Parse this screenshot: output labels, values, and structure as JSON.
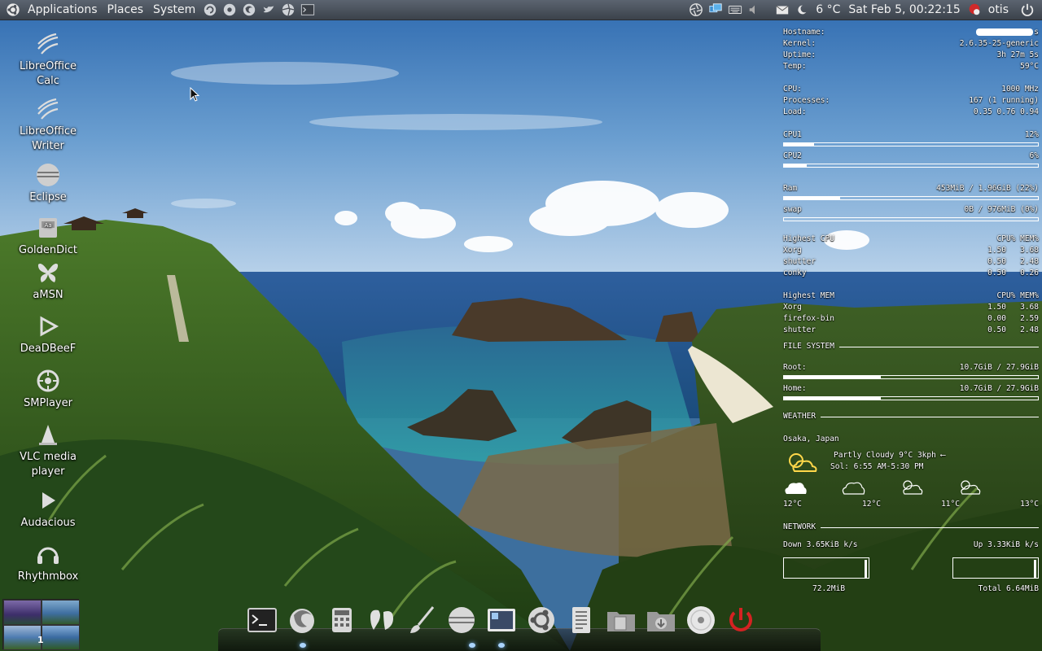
{
  "top_panel": {
    "menus": [
      "Applications",
      "Places",
      "System"
    ],
    "weather": "6 °C",
    "clock": "Sat Feb  5, 00:22:15",
    "user": "otis"
  },
  "desktop_icons": [
    {
      "label": "LibreOffice Calc",
      "icon": "libreoffice-calc-icon"
    },
    {
      "label": "LibreOffice Writer",
      "icon": "libreoffice-writer-icon"
    },
    {
      "label": "Eclipse",
      "icon": "eclipse-icon"
    },
    {
      "label": "GoldenDict",
      "icon": "goldendict-icon"
    },
    {
      "label": "aMSN",
      "icon": "amsn-icon"
    },
    {
      "label": "DeaDBeeF",
      "icon": "deadbeef-icon"
    },
    {
      "label": "SMPlayer",
      "icon": "smplayer-icon"
    },
    {
      "label": "VLC media player",
      "icon": "vlc-icon"
    },
    {
      "label": "Audacious",
      "icon": "audacious-icon"
    },
    {
      "label": "Rhythmbox",
      "icon": "rhythmbox-icon"
    }
  ],
  "conky": {
    "system": [
      {
        "label": "Hostname:",
        "value": "s"
      },
      {
        "label": "Kernel:",
        "value": "2.6.35-25-generic"
      },
      {
        "label": "Uptime:",
        "value": "3h 27m 5s"
      },
      {
        "label": "Temp:",
        "value": "59°C"
      }
    ],
    "cpu_info": [
      {
        "label": "CPU:",
        "value": "1000 MHz"
      },
      {
        "label": "Processes:",
        "value": "167 (1 running)"
      },
      {
        "label": "Load:",
        "value": "0.35 0.76 0.94"
      }
    ],
    "cpu1": {
      "label": "CPU1",
      "value": "12%",
      "fraction": 0.12
    },
    "cpu2": {
      "label": "CPU2",
      "value": "6%",
      "fraction": 0.09
    },
    "ram": {
      "label": "Ram",
      "value": "453MiB / 1.96GiB (22%)",
      "fraction": 0.22
    },
    "swap": {
      "label": "swap",
      "value": "0B / 976MiB (0%)",
      "fraction": 0.0
    },
    "highest_cpu": {
      "title": "Highest CPU",
      "header": "CPU% MEM%",
      "rows": [
        {
          "name": "Xorg",
          "cpu": "1.50",
          "mem": "3.68"
        },
        {
          "name": "shutter",
          "cpu": "0.50",
          "mem": "2.48"
        },
        {
          "name": "conky",
          "cpu": "0.50",
          "mem": "0.26"
        }
      ]
    },
    "highest_mem": {
      "title": "Highest MEM",
      "header": "CPU% MEM%",
      "rows": [
        {
          "name": "Xorg",
          "cpu": "1.50",
          "mem": "3.68"
        },
        {
          "name": "firefox-bin",
          "cpu": "0.00",
          "mem": "2.59"
        },
        {
          "name": "shutter",
          "cpu": "0.50",
          "mem": "2.48"
        }
      ]
    },
    "filesystem": {
      "title": "FILE SYSTEM",
      "root": {
        "label": "Root:",
        "value": "10.7GiB / 27.9GiB",
        "fraction": 0.38
      },
      "home": {
        "label": "Home:",
        "value": "10.7GiB / 27.9GiB",
        "fraction": 0.38
      }
    },
    "weather": {
      "title": "WEATHER",
      "location": "Osaka, Japan",
      "current": "Partly Cloudy  9°C  3kph ⟵",
      "sun": "Sol: 6:55 AM-5:30 PM",
      "forecast_temps": [
        "12°C",
        "12°C",
        "11°C",
        "13°C"
      ]
    },
    "network": {
      "title": "NETWORK",
      "down": "Down 3.65KiB k/s",
      "up": "Up 3.33KiB k/s",
      "total_down": "72.2MiB",
      "total_up": "Total 6.64MiB"
    }
  },
  "workspace": {
    "current": "1"
  },
  "dock": [
    "terminal-icon",
    "firefox-icon",
    "calculator-icon",
    "pidgin-icon",
    "brush-icon",
    "hard-disk-icon",
    "window-manager-icon",
    "ubuntu-software-icon",
    "text-editor-icon",
    "folder-documents-icon",
    "folder-downloads-icon",
    "disc-icon",
    "power-icon"
  ]
}
